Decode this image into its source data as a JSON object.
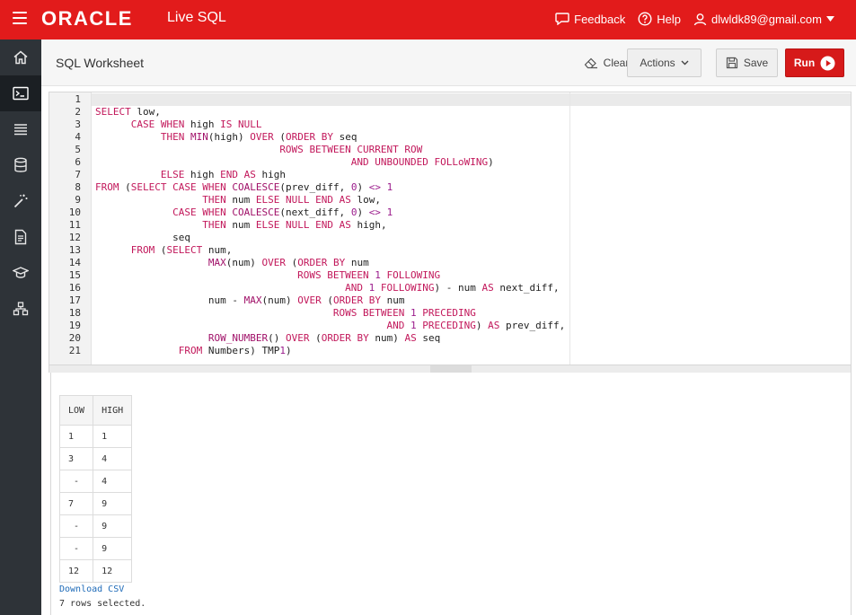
{
  "app": {
    "logo_text": "ORACLE",
    "product_text": "Live SQL",
    "menu_icon": "hamburger-icon"
  },
  "topbar": {
    "feedback_label": "Feedback",
    "help_label": "Help",
    "user_email": "dlwldk89@gmail.com"
  },
  "header": {
    "title": "SQL Worksheet",
    "clear_label": "Clear",
    "actions_label": "Actions",
    "save_label": "Save",
    "run_label": "Run"
  },
  "nav": {
    "items": [
      "home-icon",
      "terminal-icon",
      "list-icon",
      "database-icon",
      "wand-icon",
      "document-icon",
      "graduation-icon",
      "schema-icon"
    ],
    "active_index": 1
  },
  "editor": {
    "lines": [
      "",
      "SELECT low,",
      "      CASE WHEN high IS NULL",
      "           THEN MIN(high) OVER (ORDER BY seq",
      "                               ROWS BETWEEN CURRENT ROW",
      "                                           AND UNBOUNDED FOLLoWING)",
      "           ELSE high END AS high",
      "FROM (SELECT CASE WHEN COALESCE(prev_diff, 0) <> 1",
      "                  THEN num ELSE NULL END AS low,",
      "             CASE WHEN COALESCE(next_diff, 0) <> 1",
      "                  THEN num ELSE NULL END AS high,",
      "             seq",
      "      FROM (SELECT num,",
      "                   MAX(num) OVER (ORDER BY num",
      "                                  ROWS BETWEEN 1 FOLLOWING",
      "                                          AND 1 FOLLOWING) - num AS next_diff,",
      "                   num - MAX(num) OVER (ORDER BY num",
      "                                        ROWS BETWEEN 1 PRECEDING",
      "                                                 AND 1 PRECEDING) AS prev_diff,",
      "                   ROW_NUMBER() OVER (ORDER BY num) AS seq",
      "              FROM Numbers) TMP1)"
    ]
  },
  "results": {
    "columns": [
      "LOW",
      "HIGH"
    ],
    "rows": [
      [
        "1",
        "1"
      ],
      [
        "3",
        "4"
      ],
      [
        "-",
        "4"
      ],
      [
        "7",
        "9"
      ],
      [
        "-",
        "9"
      ],
      [
        "-",
        "9"
      ],
      [
        "12",
        "12"
      ]
    ],
    "download_label": "Download CSV",
    "rows_selected_text": "7 rows selected."
  },
  "colors": {
    "brand_red": "#e21b1b",
    "nav_dark": "#2e3338",
    "keyword": "#c2185b"
  }
}
